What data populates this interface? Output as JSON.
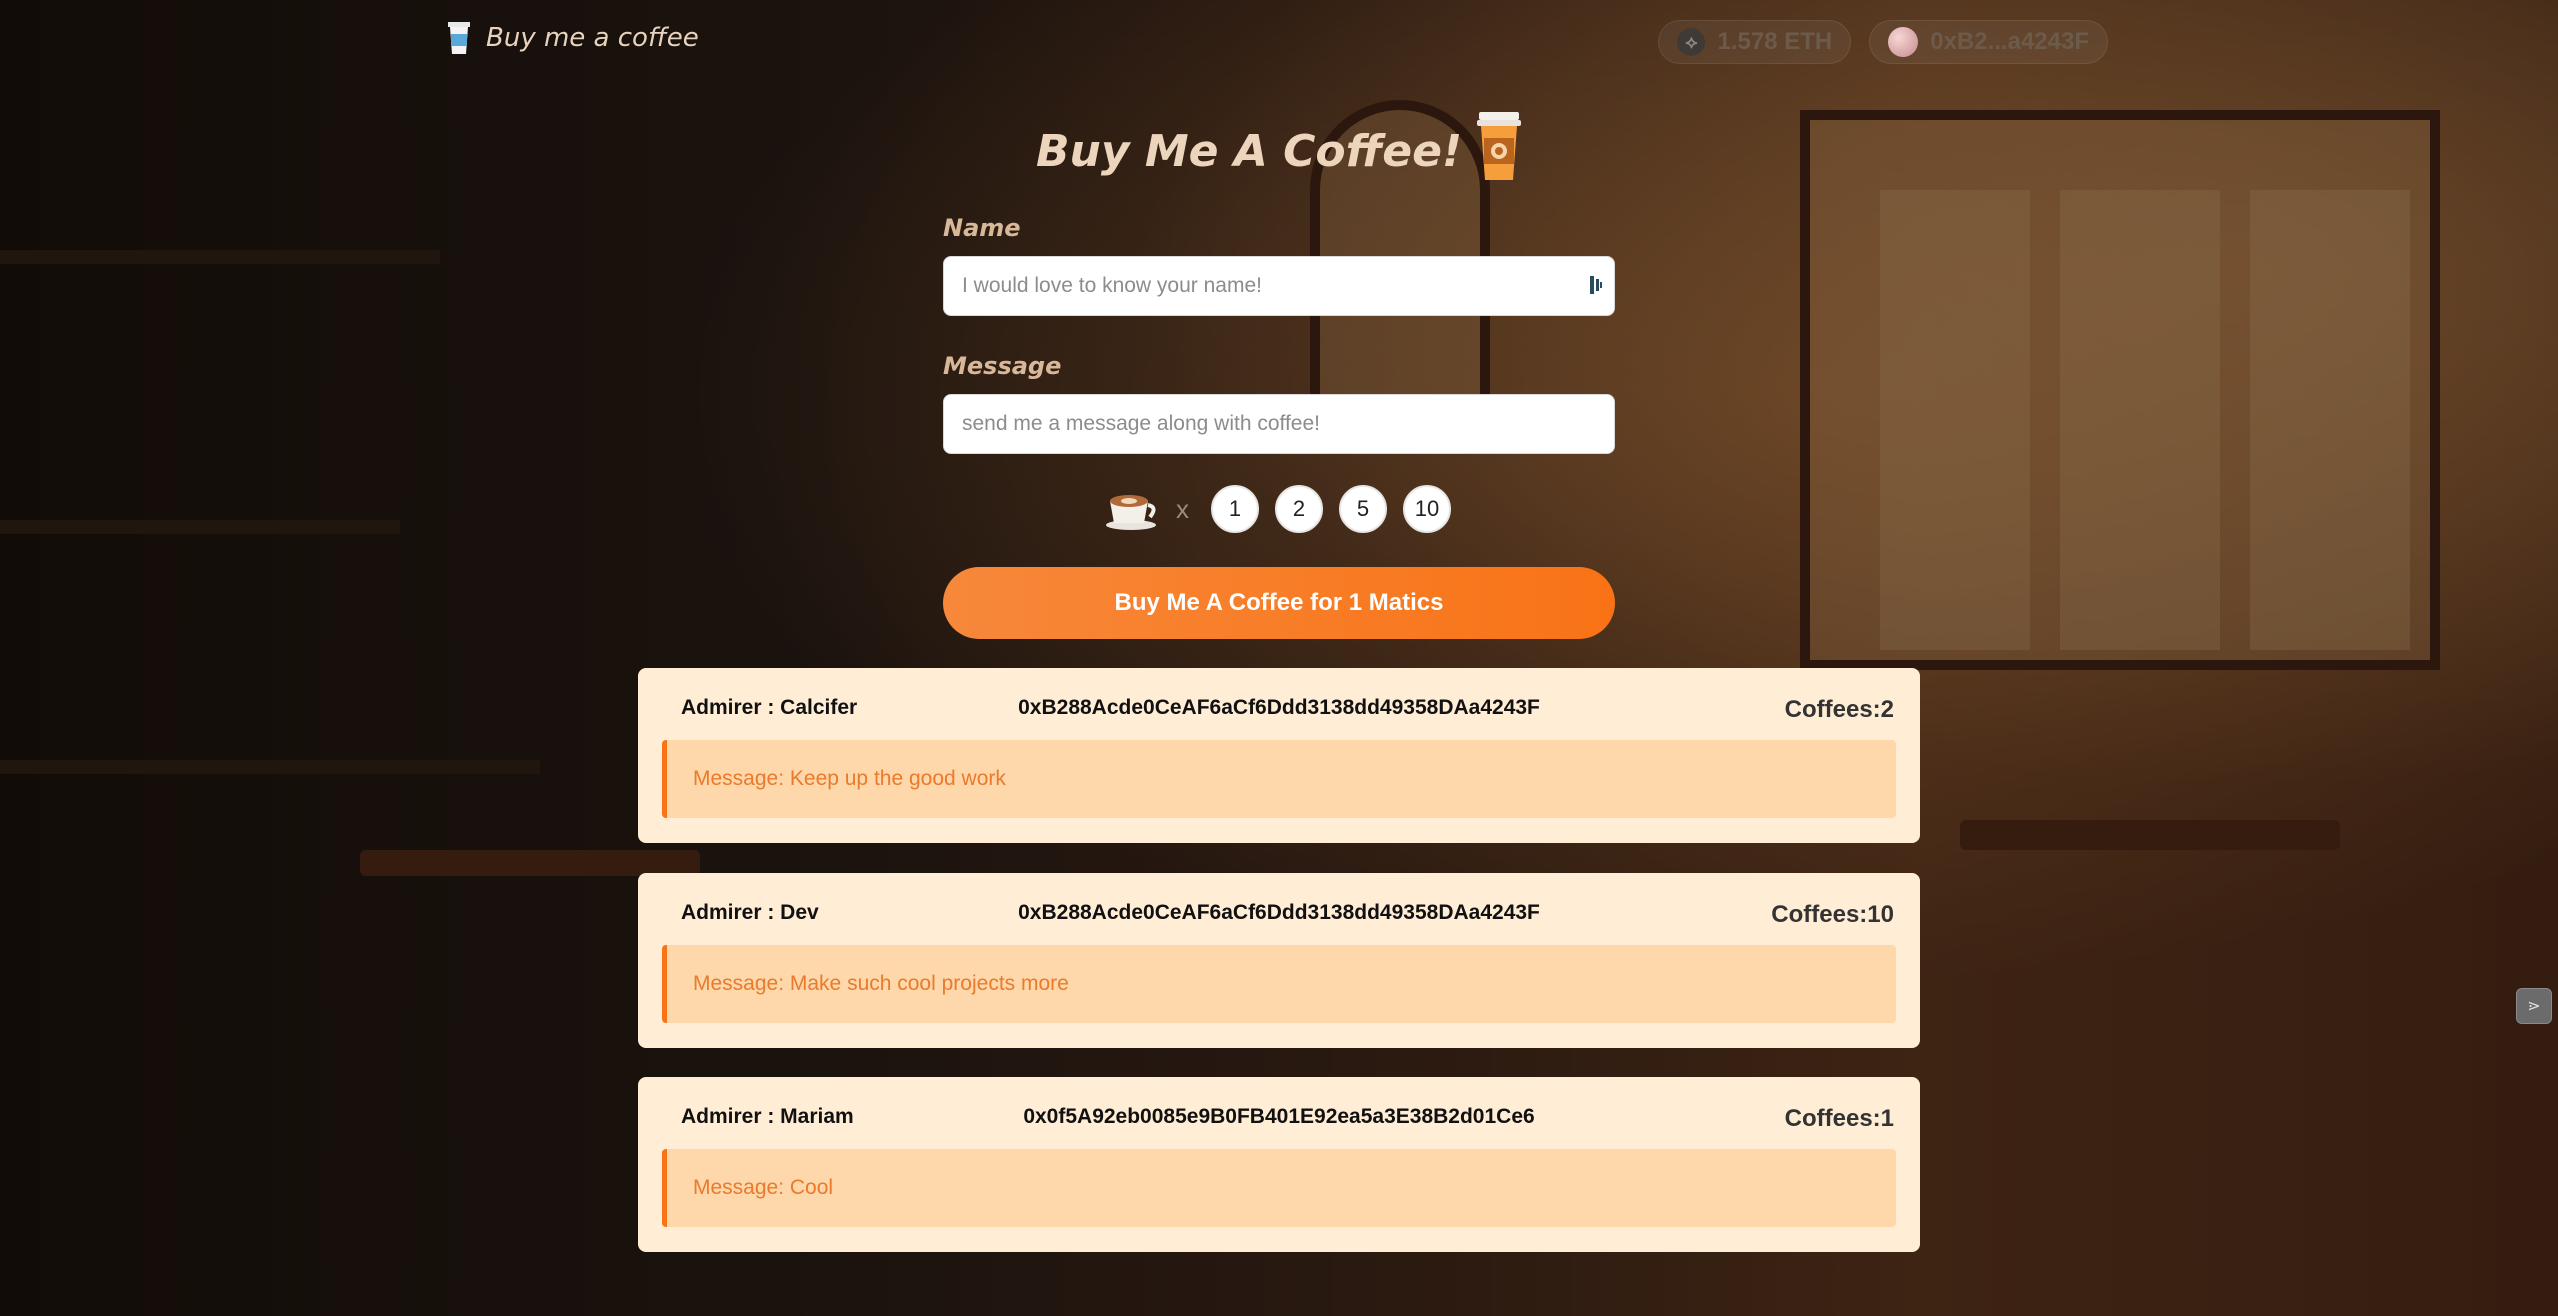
{
  "header": {
    "brand_label": "Buy me a coffee",
    "brand_icon": "coffee-cup-icon",
    "balance": "1.578 ETH",
    "account": "0xB2...a4243F"
  },
  "main": {
    "title": "Buy Me A Coffee!",
    "name_label": "Name",
    "name_placeholder": "I would love to know your name!",
    "message_label": "Message",
    "message_placeholder": "send me a message along with coffee!",
    "times_symbol": "x",
    "quantities": [
      "1",
      "2",
      "5",
      "10"
    ],
    "buy_button_label": "Buy Me A Coffee for 1 Matics"
  },
  "memos": [
    {
      "admirer": "Admirer : Calcifer",
      "address": "0xB288Acde0CeAF6aCf6Ddd3138dd49358DAa4243F",
      "coffees": "Coffees:2",
      "message": "Message: Keep up the good work"
    },
    {
      "admirer": "Admirer : Dev",
      "address": "0xB288Acde0CeAF6aCf6Ddd3138dd49358DAa4243F",
      "coffees": "Coffees:10",
      "message": "Message: Make such cool projects more"
    },
    {
      "admirer": "Admirer : Mariam",
      "address": "0x0f5A92eb0085e9B0FB401E92ea5a3E38B2d01Ce6",
      "coffees": "Coffees:1",
      "message": "Message: Cool"
    }
  ],
  "colors": {
    "accent": "#f97316",
    "memo_bg": "#ffedd6",
    "memo_message_bg": "#fed7aa"
  }
}
